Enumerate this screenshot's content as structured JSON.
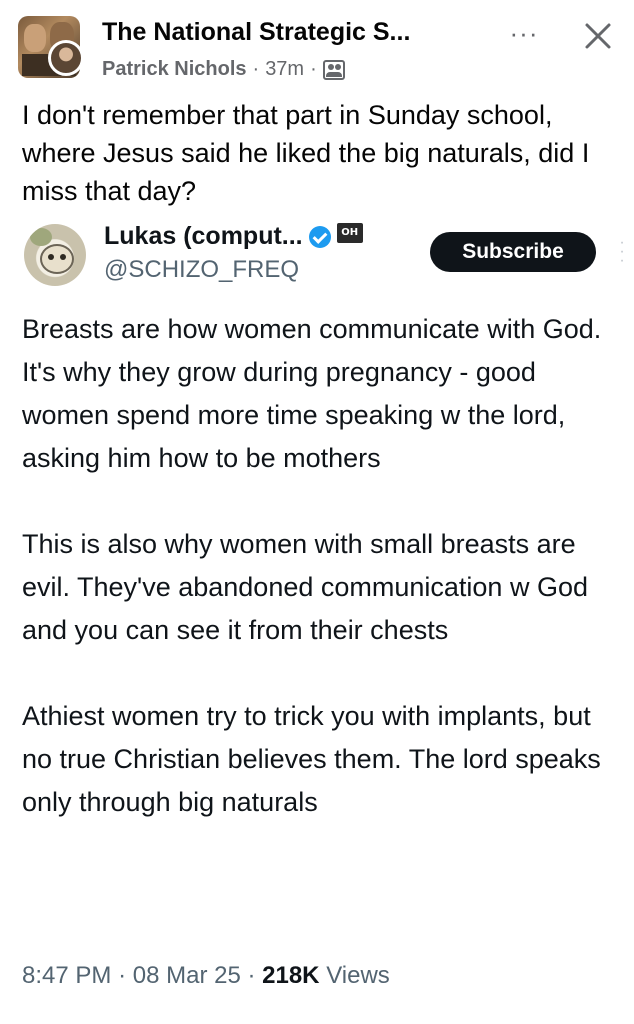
{
  "post": {
    "group_name": "The National Strategic S...",
    "author": "Patrick Nichols",
    "separator": "·",
    "time": "37m",
    "more_label": "···",
    "caption": "I don't remember that part in Sunday school, where Jesus said he liked the big naturals, did I miss that day?"
  },
  "tweet": {
    "display_name": "Lukas (comput...",
    "handle": "@SCHIZO_FREQ",
    "affiliate_label": "OH",
    "subscribe_label": "Subscribe",
    "paragraphs": [
      "Breasts are how women communicate with God. It's why they grow during pregnancy - good women spend more time speaking w the lord, asking him how to be mothers",
      "This is also why women with small breasts are evil. They've abandoned communication w God and you can see it from their chests",
      "Athiest women try to trick you with implants, but no true Christian believes them. The lord speaks only through big naturals"
    ],
    "time": "8:47 PM",
    "date": "08 Mar 25",
    "views_count": "218K",
    "views_label": "Views"
  },
  "icons": {
    "close": "close-icon",
    "more": "more-icon",
    "audience": "group-audience-icon",
    "verified": "verified-badge-icon"
  },
  "colors": {
    "verified_blue": "#1d9bf0",
    "secondary_text": "#65676b",
    "tweet_secondary": "#536471",
    "subscribe_bg": "#0f1419"
  }
}
